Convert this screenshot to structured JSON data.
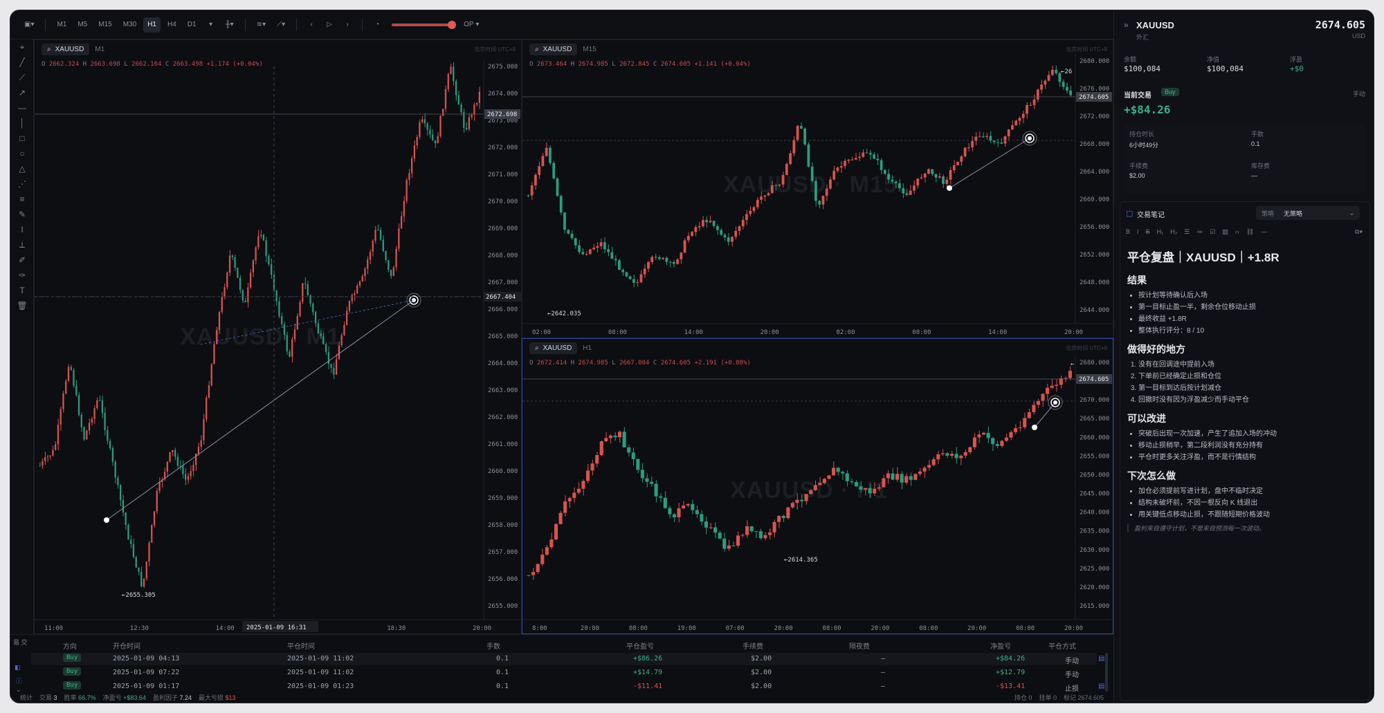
{
  "toolbar": {
    "timeframes": [
      "M1",
      "M5",
      "M15",
      "M30",
      "H1",
      "H4",
      "D1"
    ],
    "active_tf": "H1",
    "op_label": "OP"
  },
  "pane1": {
    "symbol": "XAUUSD",
    "tf": "M1",
    "tz": "北京时间 UTC+8",
    "watermark": "XAUUSD · M1",
    "ohlc": {
      "o": "2662.324",
      "h": "2663.698",
      "l": "2662.164",
      "c": "2663.498",
      "chg": "+1.174 (+0.04%)"
    },
    "price_ticks": [
      "2675.000",
      "2674.000",
      "2673.000",
      "2672.000",
      "2671.000",
      "2670.000",
      "2669.000",
      "2668.000",
      "2667.000",
      "2666.000",
      "2665.000",
      "2664.000",
      "2663.000",
      "2662.000",
      "2661.000",
      "2660.000",
      "2659.000",
      "2658.000",
      "2657.000",
      "2656.000",
      "2655.000"
    ],
    "time_ticks": [
      "11:00",
      "12:30",
      "14:00",
      "15:3",
      "18:30",
      "20:00"
    ],
    "crosshair_time": "2025-01-09 16:31",
    "last_price": "2672.698",
    "cross_price": "2667.404",
    "low_label": "←2655.305"
  },
  "pane2": {
    "symbol": "XAUUSD",
    "tf": "M15",
    "tz": "北京时间 UTC+8",
    "watermark": "XAUUSD · M15",
    "ohlc": {
      "o": "2673.464",
      "h": "2674.985",
      "l": "2672.845",
      "c": "2674.605",
      "chg": "+1.141 (+0.04%)"
    },
    "price_ticks": [
      "2680.000",
      "2676.000",
      "2672.000",
      "2668.000",
      "2664.000",
      "2660.000",
      "2656.000",
      "2652.000",
      "2648.000",
      "2644.000"
    ],
    "time_ticks": [
      "02:00",
      "08:00",
      "14:00",
      "20:00",
      "02:00",
      "08:00",
      "14:00",
      "20:00"
    ],
    "last_price": "2674.605",
    "low_label": "←2642.035",
    "high_label": "←26"
  },
  "pane3": {
    "symbol": "XAUUSD",
    "tf": "H1",
    "tz": "北京时间 UTC+8",
    "watermark": "XAUUSD · H1",
    "ohlc": {
      "o": "2672.414",
      "h": "2674.985",
      "l": "2667.004",
      "c": "2674.605",
      "chg": "+2.191 (+0.08%)"
    },
    "price_ticks": [
      "2680.000",
      "2675.000",
      "2670.000",
      "2665.000",
      "2660.000",
      "2655.000",
      "2650.000",
      "2645.000",
      "2640.000",
      "2635.000",
      "2630.000",
      "2625.000",
      "2620.000",
      "2615.000"
    ],
    "time_ticks": [
      "8:00",
      "20:00",
      "08:00",
      "19:00",
      "07:00",
      "20:00",
      "08:00",
      "20:00",
      "08:00",
      "20:00",
      "08:00",
      "20:00"
    ],
    "last_price": "2674.605",
    "low_label": "←2614.365",
    "high_label": "←"
  },
  "right": {
    "symbol": "XAUUSD",
    "sub": "外汇",
    "price": "2674.605",
    "currency": "USD",
    "balance_label": "余额",
    "balance": "$100,084",
    "equity_label": "净值",
    "equity": "$100,084",
    "float_label": "浮盈",
    "float": "+$0",
    "cur_trade_label": "当前交易",
    "cur_side": "Buy",
    "cur_mode": "手动",
    "cur_pnl": "+$84.26",
    "hold_label": "持仓时长",
    "hold": "6小时49分",
    "lots_label": "手数",
    "lots": "0.1",
    "fee_label": "手续费",
    "fee": "$2.00",
    "swap_label": "库存费",
    "swap": "—",
    "notes_title": "交易笔记",
    "strategy_label": "策略",
    "strategy": "无策略",
    "note_title": "平仓复盘｜XAUUSD｜+1.8R",
    "s1": "结果",
    "s1_items": [
      "按计划等待确认后入场",
      "第一目标止盈一半，剩余仓位移动止损",
      "最终收益 +1.8R",
      "整体执行评分：8 / 10"
    ],
    "s2": "做得好的地方",
    "s2_items": [
      "没有在回调途中提前入场",
      "下单前已经确定止损和仓位",
      "第一目标到达后按计划减仓",
      "回撤时没有因为浮盈减少而手动平仓"
    ],
    "s3": "可以改进",
    "s3_items": [
      "突破后出现一次加速，产生了追加入场的冲动",
      "移动止损稍早，第二段利润没有充分持有",
      "平仓时更多关注浮盈，而不是行情结构"
    ],
    "s4": "下次怎么做",
    "s4_items": [
      "加仓必须提前写进计划，盘中不临时决定",
      "结构未破坏前，不因一根反向 K 线退出",
      "用关键低点移动止损，不跟随短期价格波动"
    ],
    "quote": "盈利来自遵守计划，不是来自预测每一次波动。"
  },
  "table": {
    "headers": [
      "方向",
      "开仓时间",
      "平仓时间",
      "手数",
      "平仓盈亏",
      "手续费",
      "隔夜费",
      "净盈亏",
      "平仓方式"
    ],
    "side_tabs": [
      "易",
      "交"
    ],
    "rows": [
      {
        "side": "Buy",
        "open": "2025-01-09 04:13",
        "close": "2025-01-09 11:02",
        "lots": "0.1",
        "pnl": "+$86.26",
        "fee": "$2.00",
        "swap": "—",
        "net": "+$84.26",
        "mode": "手动"
      },
      {
        "side": "Buy",
        "open": "2025-01-09 07:22",
        "close": "2025-01-09 11:02",
        "lots": "0.1",
        "pnl": "+$14.79",
        "fee": "$2.00",
        "swap": "—",
        "net": "+$12.79",
        "mode": "手动"
      },
      {
        "side": "Buy",
        "open": "2025-01-09 01:17",
        "close": "2025-01-09 01:23",
        "lots": "0.1",
        "pnl": "-$11.41",
        "fee": "$2.00",
        "swap": "—",
        "net": "-$13.41",
        "mode": "止损"
      }
    ]
  },
  "status": {
    "stats": "统计",
    "total_label": "交易",
    "total": "3",
    "win_label": "胜率",
    "win": "66.7%",
    "net_label": "净盈亏",
    "net": "+$83.64",
    "pf_label": "盈利因子",
    "pf": "7.24",
    "dd_label": "最大亏损",
    "dd": "$13",
    "pos": "持仓 0",
    "orders": "挂单 0",
    "mark": "标记 2674.605"
  }
}
